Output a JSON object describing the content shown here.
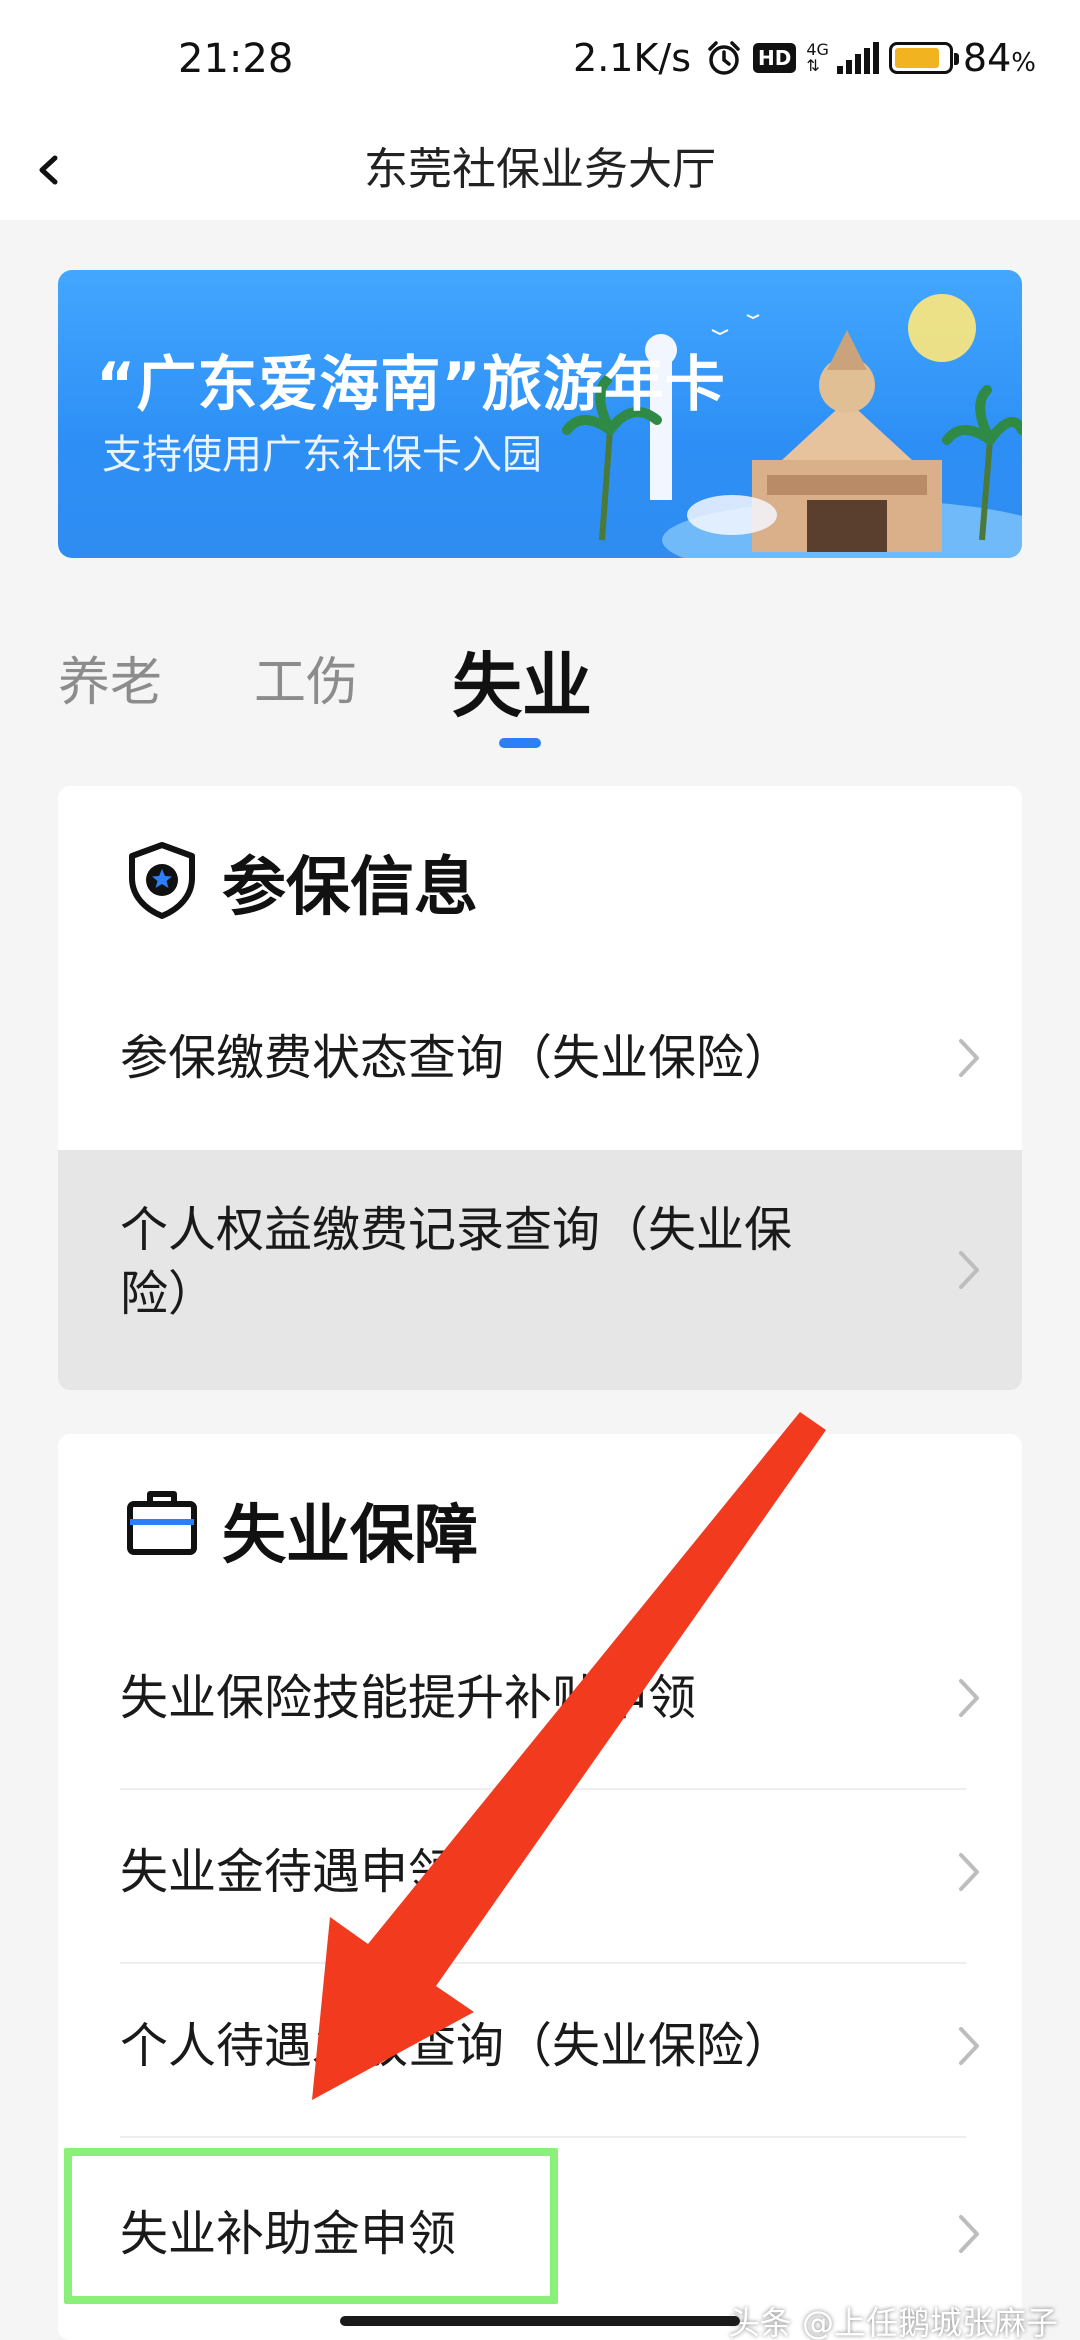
{
  "status_bar": {
    "time": "21:28",
    "speed": "2.1K/s",
    "hd": "HD",
    "network": "4G",
    "battery_level": 0.84,
    "battery_text": "84",
    "battery_unit": "%"
  },
  "header": {
    "title": "东莞社保业务大厅"
  },
  "banner": {
    "title": "“广东爱海南”旅游年卡",
    "subtitle": "支持使用广东社保卡入园"
  },
  "tabs": [
    {
      "label": "养老",
      "active": false
    },
    {
      "label": "工伤",
      "active": false
    },
    {
      "label": "失业",
      "active": true
    }
  ],
  "section_insurance": {
    "title": "参保信息",
    "items": [
      {
        "label": "参保缴费状态查询（失业保险）"
      },
      {
        "label_line1": "个人权益缴费记录查询（失业保",
        "label_line2": "险）"
      }
    ]
  },
  "section_unemployment": {
    "title": "失业保障",
    "items": [
      {
        "label": "失业保险技能提升补贴申领"
      },
      {
        "label": "失业金待遇申领"
      },
      {
        "label": "个人待遇发放查询（失业保险）"
      },
      {
        "label": "失业补助金申领"
      }
    ]
  },
  "watermark": "头条 @上任鹅城张麻子",
  "colors": {
    "accent": "#2d7ff9",
    "highlight": "#8af07a",
    "arrow": "#f23a1f",
    "battery": "#f2b320"
  }
}
